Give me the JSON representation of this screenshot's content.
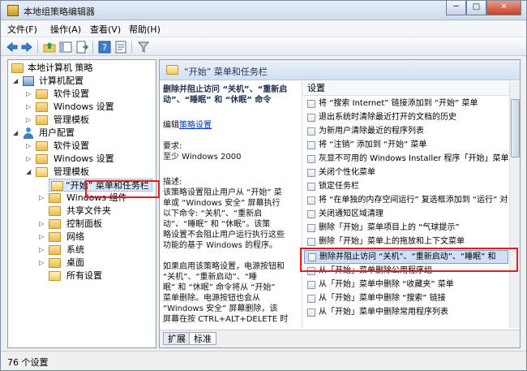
{
  "window": {
    "title": "本地组策略编辑器",
    "controls": [
      "minimize",
      "maximize",
      "close"
    ]
  },
  "menus": [
    {
      "label": "文件(F)"
    },
    {
      "label": "操作(A)"
    },
    {
      "label": "查看(V)"
    },
    {
      "label": "帮助(H)"
    }
  ],
  "toolbar": {
    "icons": [
      "back-arrow-icon",
      "forward-arrow-icon",
      "folder-up-icon",
      "show-hide-tree-icon",
      "export-list-icon",
      "help-icon",
      "properties-icon",
      "filter-icon"
    ]
  },
  "tree": {
    "root": "本地计算机 策略",
    "items": [
      {
        "label": "计算机配置"
      },
      {
        "label": "软件设置"
      },
      {
        "label": "Windows 设置"
      },
      {
        "label": "管理模板"
      },
      {
        "label": "用户配置"
      },
      {
        "label": "软件设置"
      },
      {
        "label": "Windows 设置"
      },
      {
        "label": "管理模板"
      },
      {
        "label": "“开始” 菜单和任务栏"
      },
      {
        "label": "Windows 组件"
      },
      {
        "label": "共享文件夹"
      },
      {
        "label": "控制面板"
      },
      {
        "label": "网络"
      },
      {
        "label": "系统"
      },
      {
        "label": "桌面"
      },
      {
        "label": "所有设置"
      }
    ]
  },
  "detail": {
    "header": "“开始” 菜单和任务栏",
    "desc": {
      "title_l1": "删除并阻止访问 “关机”、“重新启",
      "title_l2": "动”、“睡眠” 和 “休眠” 命令",
      "edit_prefix": "编辑",
      "edit_link": "策略设置",
      "req_label": "要求:",
      "req_value": "至少 Windows 2000",
      "desc_label": "描述:",
      "p1_l1": "该策略设置阻止用户从 “开始” 菜",
      "p1_l2": "单或 “Windows 安全” 屏幕执行",
      "p1_l3": "以下命令: “关机”、“重新启",
      "p1_l4": "动”、“睡眠” 和 “休眠”。该策",
      "p1_l5": "略设置不会阻止用户运行执行这些",
      "p1_l6": "功能的基于 Windows 的程序。",
      "p2_l1": "如果启用该策略设置，电源按钮和",
      "p2_l2": "“关机”、“重新启动”、“睡",
      "p2_l3": "眠” 和 “休眠” 命令将从 “开始”",
      "p2_l4": "菜单删除。电源按钮也会从",
      "p2_l5": "“Windows 安全” 屏幕删除，该",
      "p2_l6": "屏幕在按 CTRL+ALT+DELETE 时"
    },
    "list_header": "设置",
    "rows": [
      {
        "label": "将 “搜索 Internet” 链接添加到 “开始” 菜单"
      },
      {
        "label": "退出系统时清除最近打开的文档的历史"
      },
      {
        "label": "为新用户清除最近的程序列表"
      },
      {
        "label": "将 “注销” 添加到 “开始” 菜单"
      },
      {
        "label": "灰显不可用的 Windows Installer 程序「开始」菜单"
      },
      {
        "label": "关闭个性化菜单"
      },
      {
        "label": "锁定任务栏"
      },
      {
        "label": "将 “在单独的内存空间运行” 复选框添加到 “运行” 对"
      },
      {
        "label": "关闭通知区域清理"
      },
      {
        "label": "删除「开始」菜单项目上的 “气球提示”"
      },
      {
        "label": "删除「开始」菜单上的拖放和上下文菜单"
      },
      {
        "label": "删除并阻止访问 “关机”、“重新启动”、“睡眠” 和"
      },
      {
        "label": "从「开始」菜单删除公用程序组"
      },
      {
        "label": "从「开始」菜单中删除 “收藏夹” 菜单"
      },
      {
        "label": "从「开始」菜单中删除 “搜索” 链接"
      },
      {
        "label": "从「开始」菜单中删除常用程序列表"
      }
    ],
    "tabs": [
      {
        "label": "扩展"
      },
      {
        "label": "标准"
      }
    ]
  },
  "status": {
    "text": "76 个设置"
  },
  "colors": {
    "highlight": "#e41c1c",
    "selection": "#cfe0f6",
    "link": "#0033cc"
  }
}
